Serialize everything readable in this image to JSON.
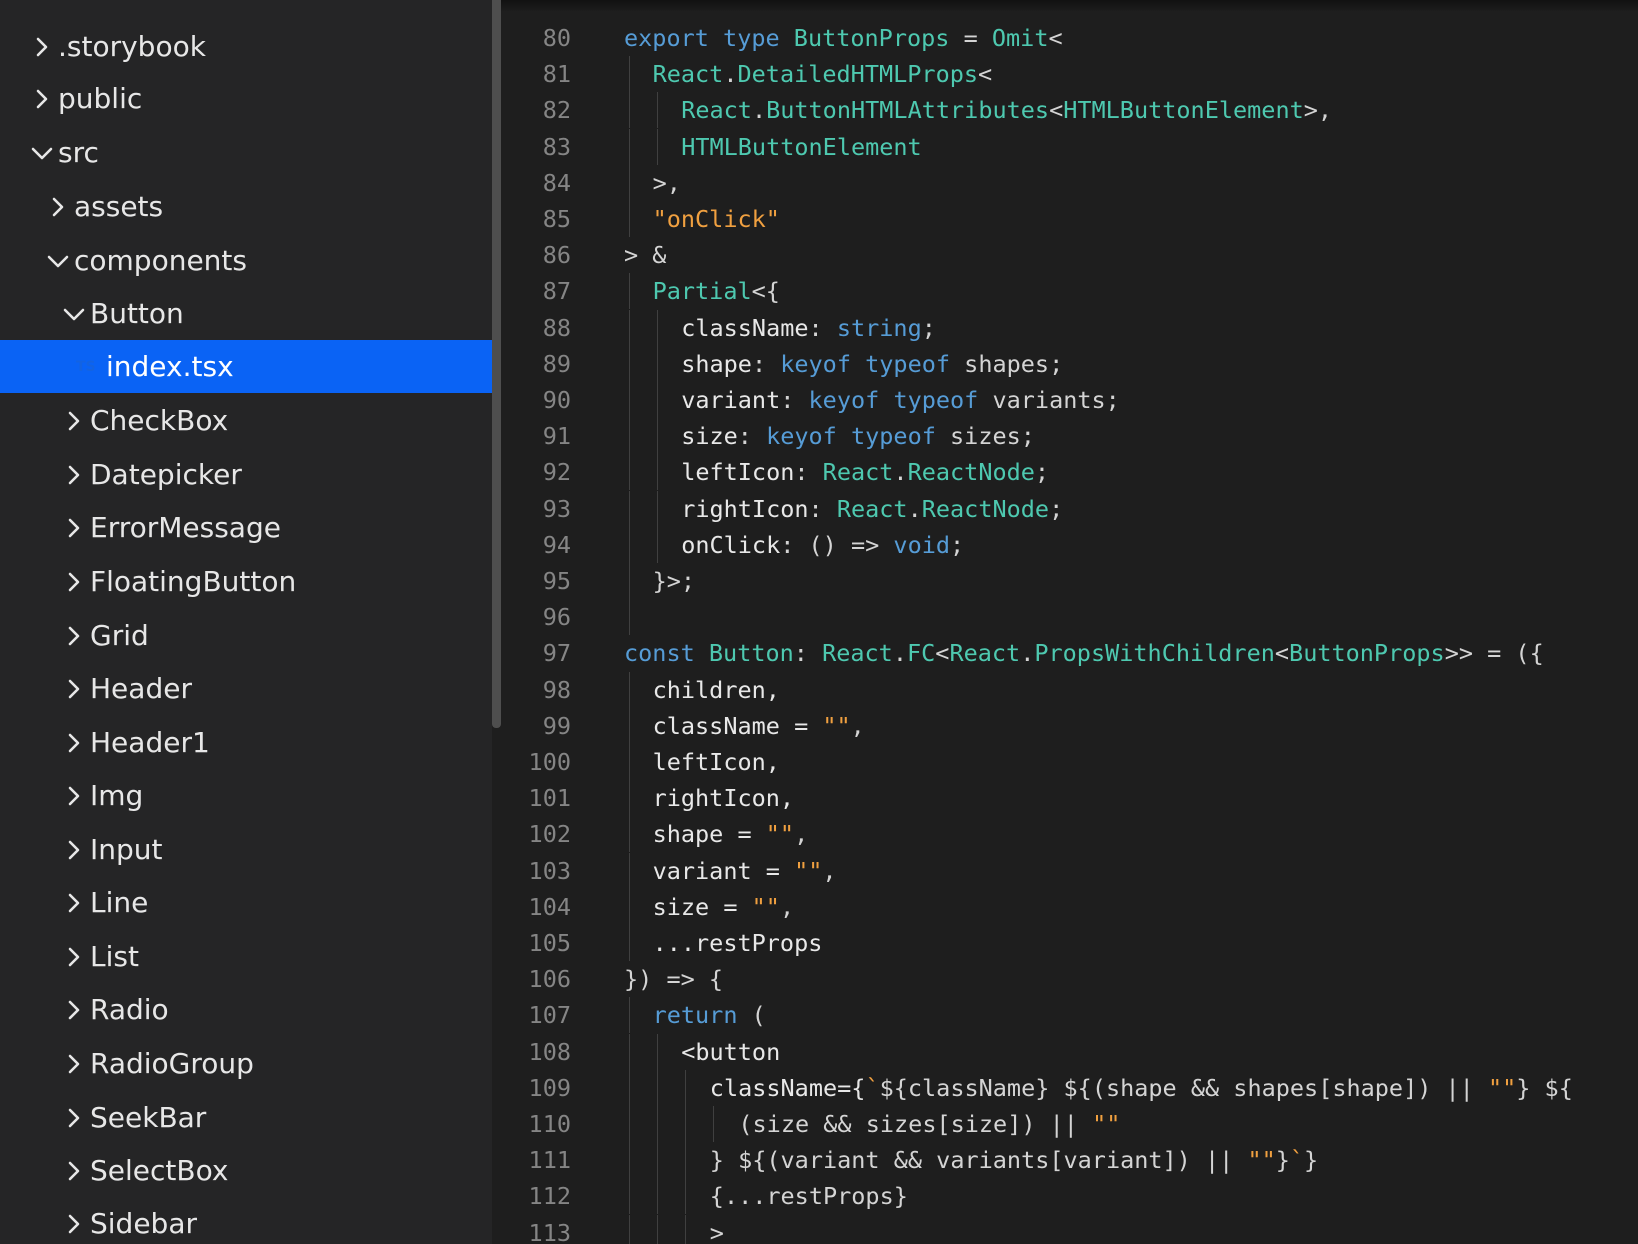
{
  "explorer": {
    "top_partial": "",
    "items": [
      {
        "label": ".storybook",
        "expanded": false
      },
      {
        "label": "public",
        "expanded": false
      },
      {
        "label": "src",
        "expanded": true
      },
      {
        "label": "assets",
        "expanded": false
      },
      {
        "label": "components",
        "expanded": true
      },
      {
        "label": "Button",
        "expanded": true
      },
      {
        "label": "index.tsx",
        "file_icon": "TS",
        "selected": true
      },
      {
        "label": "CheckBox",
        "expanded": false
      },
      {
        "label": "Datepicker",
        "expanded": false
      },
      {
        "label": "ErrorMessage",
        "expanded": false
      },
      {
        "label": "FloatingButton",
        "expanded": false
      },
      {
        "label": "Grid",
        "expanded": false
      },
      {
        "label": "Header",
        "expanded": false
      },
      {
        "label": "Header1",
        "expanded": false
      },
      {
        "label": "Img",
        "expanded": false
      },
      {
        "label": "Input",
        "expanded": false
      },
      {
        "label": "Line",
        "expanded": false
      },
      {
        "label": "List",
        "expanded": false
      },
      {
        "label": "Radio",
        "expanded": false
      },
      {
        "label": "RadioGroup",
        "expanded": false
      },
      {
        "label": "SeekBar",
        "expanded": false
      },
      {
        "label": "SelectBox",
        "expanded": false
      },
      {
        "label": "Sidebar",
        "expanded": false
      }
    ]
  },
  "colors": {
    "selected_row": "#0a63f5",
    "keyword": "#569cd6",
    "type": "#4ec9b0",
    "string": "#ce9178",
    "line_number": "#858585"
  },
  "editor": {
    "lines": [
      {
        "n": "80",
        "indent": 0,
        "tokens": [
          [
            "kw",
            "export"
          ],
          [
            "pl",
            " "
          ],
          [
            "kw",
            "type"
          ],
          [
            "pl",
            " "
          ],
          [
            "ty",
            "ButtonProps"
          ],
          [
            "pl",
            " = "
          ],
          [
            "ty",
            "Omit"
          ],
          [
            "pl",
            "<"
          ]
        ]
      },
      {
        "n": "81",
        "indent": 1,
        "tokens": [
          [
            "ty",
            "React"
          ],
          [
            "pl",
            "."
          ],
          [
            "ty",
            "DetailedHTMLProps"
          ],
          [
            "pl",
            "<"
          ]
        ]
      },
      {
        "n": "82",
        "indent": 2,
        "tokens": [
          [
            "ty",
            "React"
          ],
          [
            "pl",
            "."
          ],
          [
            "ty",
            "ButtonHTMLAttributes"
          ],
          [
            "pl",
            "<"
          ],
          [
            "ty",
            "HTMLButtonElement"
          ],
          [
            "pl",
            ">,"
          ]
        ]
      },
      {
        "n": "83",
        "indent": 2,
        "tokens": [
          [
            "ty",
            "HTMLButtonElement"
          ]
        ]
      },
      {
        "n": "84",
        "indent": 1,
        "tokens": [
          [
            "pl",
            ">,"
          ]
        ]
      },
      {
        "n": "85",
        "indent": 1,
        "tokens": [
          [
            "st2",
            "\"onClick\""
          ]
        ]
      },
      {
        "n": "86",
        "indent": 0,
        "tokens": [
          [
            "pl",
            "> &"
          ]
        ]
      },
      {
        "n": "87",
        "indent": 1,
        "tokens": [
          [
            "ty",
            "Partial"
          ],
          [
            "pl",
            "<{"
          ]
        ]
      },
      {
        "n": "88",
        "indent": 2,
        "tokens": [
          [
            "wh",
            "className"
          ],
          [
            "pl",
            ": "
          ],
          [
            "kw",
            "string"
          ],
          [
            "pl",
            ";"
          ]
        ]
      },
      {
        "n": "89",
        "indent": 2,
        "tokens": [
          [
            "wh",
            "shape"
          ],
          [
            "pl",
            ": "
          ],
          [
            "kw",
            "keyof"
          ],
          [
            "pl",
            " "
          ],
          [
            "kw",
            "typeof"
          ],
          [
            "pl",
            " shapes;"
          ]
        ]
      },
      {
        "n": "90",
        "indent": 2,
        "tokens": [
          [
            "wh",
            "variant"
          ],
          [
            "pl",
            ": "
          ],
          [
            "kw",
            "keyof"
          ],
          [
            "pl",
            " "
          ],
          [
            "kw",
            "typeof"
          ],
          [
            "pl",
            " variants;"
          ]
        ]
      },
      {
        "n": "91",
        "indent": 2,
        "tokens": [
          [
            "wh",
            "size"
          ],
          [
            "pl",
            ": "
          ],
          [
            "kw",
            "keyof"
          ],
          [
            "pl",
            " "
          ],
          [
            "kw",
            "typeof"
          ],
          [
            "pl",
            " sizes;"
          ]
        ]
      },
      {
        "n": "92",
        "indent": 2,
        "tokens": [
          [
            "wh",
            "leftIcon"
          ],
          [
            "pl",
            ": "
          ],
          [
            "ty",
            "React"
          ],
          [
            "pl",
            "."
          ],
          [
            "ty",
            "ReactNode"
          ],
          [
            "pl",
            ";"
          ]
        ]
      },
      {
        "n": "93",
        "indent": 2,
        "tokens": [
          [
            "wh",
            "rightIcon"
          ],
          [
            "pl",
            ": "
          ],
          [
            "ty",
            "React"
          ],
          [
            "pl",
            "."
          ],
          [
            "ty",
            "ReactNode"
          ],
          [
            "pl",
            ";"
          ]
        ]
      },
      {
        "n": "94",
        "indent": 2,
        "tokens": [
          [
            "wh",
            "onClick"
          ],
          [
            "pl",
            ": () => "
          ],
          [
            "kw",
            "void"
          ],
          [
            "pl",
            ";"
          ]
        ]
      },
      {
        "n": "95",
        "indent": 1,
        "tokens": [
          [
            "pl",
            "}>;"
          ]
        ]
      },
      {
        "n": "96",
        "indent": 1,
        "tokens": []
      },
      {
        "n": "97",
        "indent": 0,
        "tokens": [
          [
            "kw",
            "const"
          ],
          [
            "pl",
            " "
          ],
          [
            "ty",
            "Button"
          ],
          [
            "pl",
            ": "
          ],
          [
            "ty",
            "React"
          ],
          [
            "pl",
            "."
          ],
          [
            "ty",
            "FC"
          ],
          [
            "pl",
            "<"
          ],
          [
            "ty",
            "React"
          ],
          [
            "pl",
            "."
          ],
          [
            "ty",
            "PropsWithChildren"
          ],
          [
            "pl",
            "<"
          ],
          [
            "ty",
            "ButtonProps"
          ],
          [
            "pl",
            ">> = ({"
          ]
        ]
      },
      {
        "n": "98",
        "indent": 1,
        "tokens": [
          [
            "wh",
            "children,"
          ]
        ]
      },
      {
        "n": "99",
        "indent": 1,
        "tokens": [
          [
            "wh",
            "className = "
          ],
          [
            "st2",
            "\"\""
          ],
          [
            "pl",
            ","
          ]
        ]
      },
      {
        "n": "100",
        "indent": 1,
        "tokens": [
          [
            "wh",
            "leftIcon,"
          ]
        ]
      },
      {
        "n": "101",
        "indent": 1,
        "tokens": [
          [
            "wh",
            "rightIcon,"
          ]
        ]
      },
      {
        "n": "102",
        "indent": 1,
        "tokens": [
          [
            "wh",
            "shape = "
          ],
          [
            "st2",
            "\"\""
          ],
          [
            "pl",
            ","
          ]
        ]
      },
      {
        "n": "103",
        "indent": 1,
        "tokens": [
          [
            "wh",
            "variant = "
          ],
          [
            "st2",
            "\"\""
          ],
          [
            "pl",
            ","
          ]
        ]
      },
      {
        "n": "104",
        "indent": 1,
        "tokens": [
          [
            "wh",
            "size = "
          ],
          [
            "st2",
            "\"\""
          ],
          [
            "pl",
            ","
          ]
        ]
      },
      {
        "n": "105",
        "indent": 1,
        "tokens": [
          [
            "wh",
            "...restProps"
          ]
        ]
      },
      {
        "n": "106",
        "indent": 0,
        "tokens": [
          [
            "pl",
            "}) => {"
          ]
        ]
      },
      {
        "n": "107",
        "indent": 1,
        "tokens": [
          [
            "kw",
            "return"
          ],
          [
            "pl",
            " ("
          ]
        ]
      },
      {
        "n": "108",
        "indent": 2,
        "tokens": [
          [
            "wh",
            "<button"
          ]
        ]
      },
      {
        "n": "109",
        "indent": 3,
        "tokens": [
          [
            "wh",
            "className={"
          ],
          [
            "st2",
            "`"
          ],
          [
            "pl",
            "${className} ${(shape && shapes[shape]) || "
          ],
          [
            "st2",
            "\"\""
          ],
          [
            "pl",
            "} ${"
          ]
        ]
      },
      {
        "n": "110",
        "indent": 4,
        "tokens": [
          [
            "pl",
            "(size && sizes[size]) || "
          ],
          [
            "st2",
            "\"\""
          ]
        ]
      },
      {
        "n": "111",
        "indent": 3,
        "tokens": [
          [
            "pl",
            "} ${(variant && variants[variant]) || "
          ],
          [
            "st2",
            "\"\""
          ],
          [
            "pl",
            "}"
          ],
          [
            "st2",
            "`"
          ],
          [
            "pl",
            "}"
          ]
        ]
      },
      {
        "n": "112",
        "indent": 3,
        "tokens": [
          [
            "pl",
            "{...restProps}"
          ]
        ]
      },
      {
        "n": "113",
        "indent": 3,
        "tokens": [
          [
            "pl",
            ">"
          ]
        ]
      }
    ]
  }
}
